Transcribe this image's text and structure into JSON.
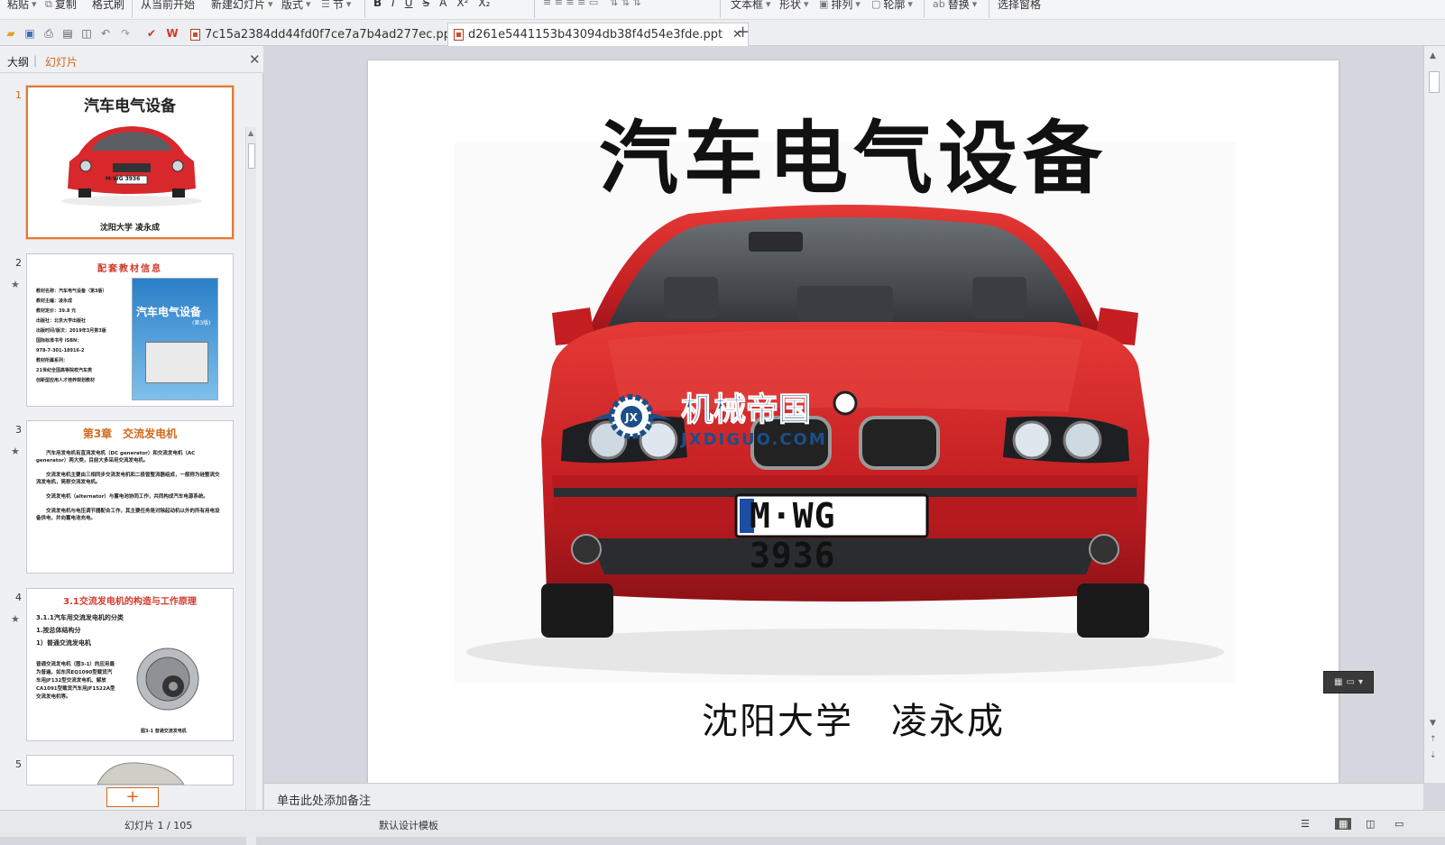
{
  "ribbon": {
    "paste": "粘贴",
    "copy": "复制",
    "format_painter": "格式刷",
    "from_current": "从当前开始",
    "new_slide": "新建幻灯片",
    "layout": "版式",
    "section": "节",
    "textbox": "文本框",
    "shape": "形状",
    "arrange": "排列",
    "outline": "轮廓",
    "replace": "替换",
    "select_pane": "选择窗格"
  },
  "tabs": [
    {
      "label": "7c15a2384dd44fd0f7ce7a7b4ad277ec.ppt",
      "active": false
    },
    {
      "label": "d261e5441153b43094db38f4d54e3fde.ppt",
      "active": true
    }
  ],
  "panel": {
    "outline_tab": "大纲",
    "slides_tab": "幻灯片"
  },
  "thumbs": [
    {
      "num": "1",
      "title": "汽车电气设备",
      "sub": "沈阳大学    凌永成",
      "plate": "M·WG 3936"
    },
    {
      "num": "2",
      "title": "配套教材信息",
      "cover_title": "汽车电气设备",
      "cover_sub": "(第3版)",
      "lines": [
        "教材名称：汽车电气设备（第3版）",
        "教材主编：凌永成",
        "教材定价：39.8 元",
        "出版社：北京大学出版社",
        "出版时间/版次：2019年3月第3版",
        "国际标准书号 ISBN：",
        "978-7-301-18916-2",
        "教材所属系列：",
        "21世纪全国高等院校汽车类",
        "创新型应用人才培养规划教材"
      ]
    },
    {
      "num": "3",
      "title": "第3章　交流发电机",
      "paras": [
        "汽车用发电机有直流发电机（DC generator）和交流发电机（AC generator）两大类，目前大多采用交流发电机。",
        "交流发电机主要由三相同步交流发电机和二极管整流器组成，一般称为硅整流交流发电机，简称交流发电机。",
        "交流发电机（alternator）与蓄电池协同工作，共同构成汽车电源系统。",
        "交流发电机与电压调节器配合工作，其主要任务是对除起动机以外的所有用电设备供电，并向蓄电池充电。"
      ]
    },
    {
      "num": "4",
      "title": "3.1交流发电机的构造与工作原理",
      "lines": [
        "3.1.1汽车用交流发电机的分类",
        "1.按总体结构分",
        "1）普通交流发电机"
      ],
      "body": "普通交流发电机（图3-1）的应用最为普遍，如东风EQ1090型载货汽车用JF132型交流发电机、解放CA1091型载货汽车用JF1522A型交流发电机等。",
      "caption": "图3-1  普通交流发电机"
    },
    {
      "num": "5"
    }
  ],
  "slide": {
    "title": "汽车电气设备",
    "subtitle": "沈阳大学　凌永成",
    "plate": "M·WG 3936",
    "watermark_cn": "机械帝国",
    "watermark_en": "JXDIGUO.COM"
  },
  "notes_placeholder": "单击此处添加备注",
  "status": {
    "slide_count": "幻灯片 1 / 105",
    "template": "默认设计模板"
  },
  "colors": {
    "accent": "#e07a3a",
    "car_red": "#d8282c"
  }
}
